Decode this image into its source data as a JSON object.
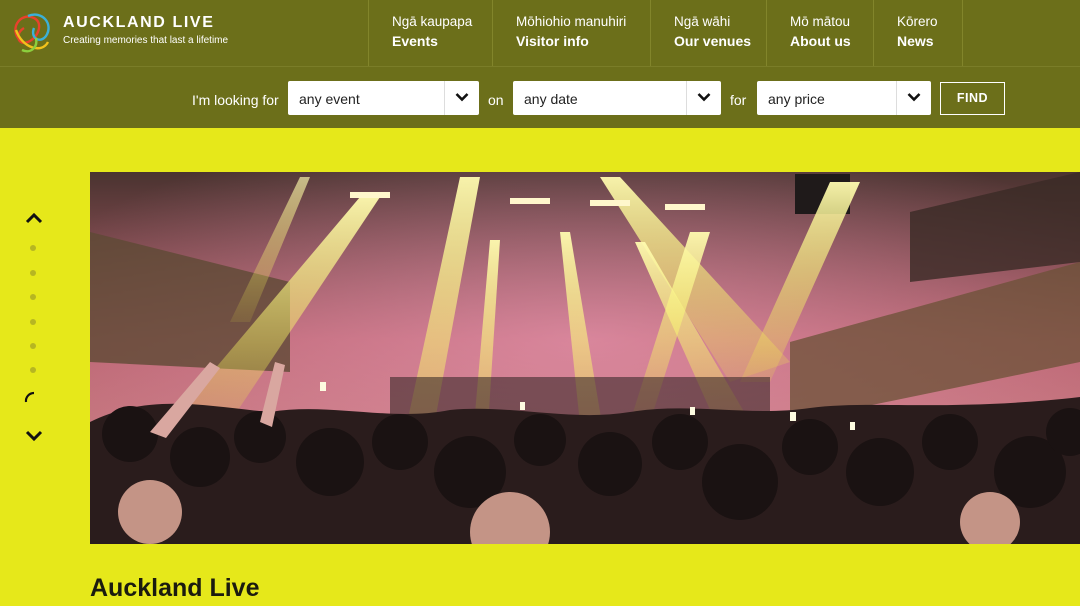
{
  "brand": {
    "title": "AUCKLAND LIVE",
    "tagline": "Creating memories that last a lifetime"
  },
  "nav": [
    {
      "maori": "Ngā kaupapa",
      "english": "Events"
    },
    {
      "maori": "Mōhiohio manuhiri",
      "english": "Visitor info"
    },
    {
      "maori": "Ngā wāhi",
      "english": "Our venues"
    },
    {
      "maori": "Mō mātou",
      "english": "About us"
    },
    {
      "maori": "Kōrero",
      "english": "News"
    }
  ],
  "search": {
    "label_looking": "I'm looking for",
    "event_value": "any event",
    "label_on": "on",
    "date_value": "any date",
    "label_for": "for",
    "price_value": "any price",
    "find_label": "FIND"
  },
  "page": {
    "title": "Auckland Live"
  },
  "colors": {
    "header_bg": "#6c6f1a",
    "page_bg": "#e6e81a"
  }
}
